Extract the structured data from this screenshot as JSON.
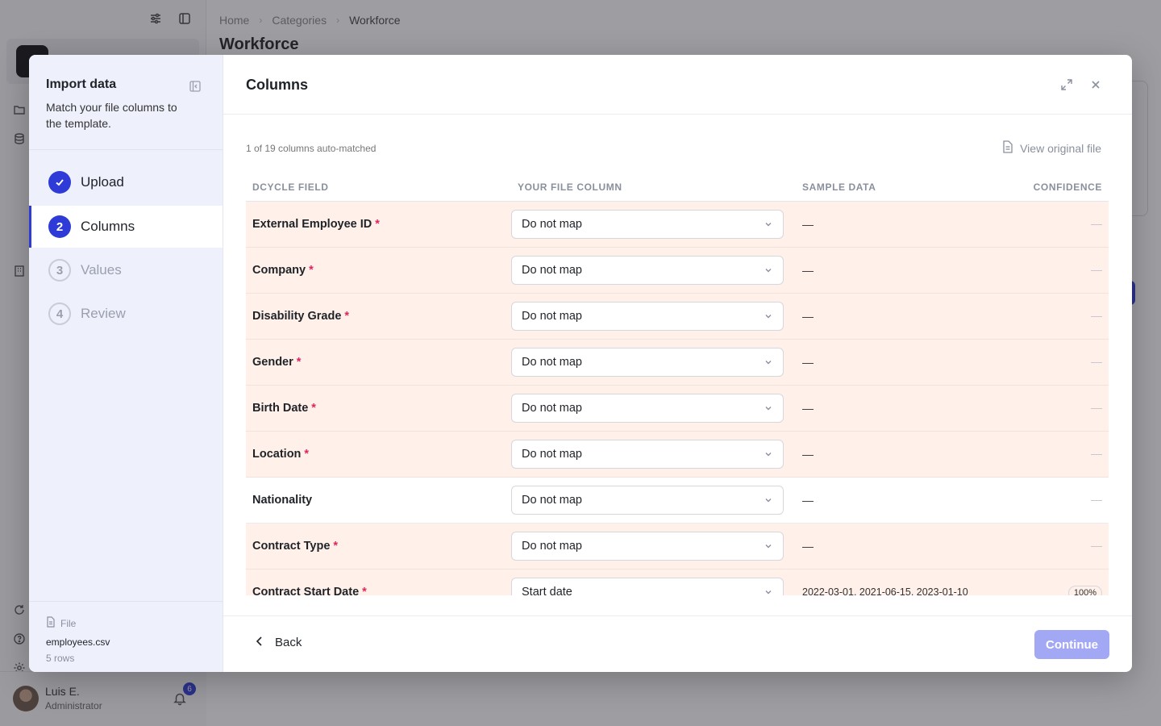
{
  "app": {
    "breadcrumb": [
      "Home",
      "Categories",
      "Workforce"
    ],
    "page_title": "Workforce",
    "user": {
      "name": "Luis E.",
      "role": "Administrator",
      "notifications": "6"
    }
  },
  "modal": {
    "sidebar": {
      "title": "Import data",
      "subtitle": "Match your file columns to the template.",
      "steps": [
        {
          "number": "1",
          "label": "Upload",
          "state": "done"
        },
        {
          "number": "2",
          "label": "Columns",
          "state": "current"
        },
        {
          "number": "3",
          "label": "Values",
          "state": "pending"
        },
        {
          "number": "4",
          "label": "Review",
          "state": "pending"
        }
      ],
      "file": {
        "label": "File",
        "name": "employees.csv",
        "rows": "5 rows"
      }
    },
    "title": "Columns",
    "matched_text": "1 of 19 columns auto-matched",
    "view_original": "View original file",
    "table": {
      "headers": [
        "DCYCLE FIELD",
        "YOUR FILE COLUMN",
        "SAMPLE DATA",
        "CONFIDENCE"
      ],
      "rows": [
        {
          "field": "External Employee ID",
          "required": true,
          "column": "Do not map",
          "sample": "—",
          "confidence": "—"
        },
        {
          "field": "Company",
          "required": true,
          "column": "Do not map",
          "sample": "—",
          "confidence": "—"
        },
        {
          "field": "Disability Grade",
          "required": true,
          "column": "Do not map",
          "sample": "—",
          "confidence": "—"
        },
        {
          "field": "Gender",
          "required": true,
          "column": "Do not map",
          "sample": "—",
          "confidence": "—"
        },
        {
          "field": "Birth Date",
          "required": true,
          "column": "Do not map",
          "sample": "—",
          "confidence": "—"
        },
        {
          "field": "Location",
          "required": true,
          "column": "Do not map",
          "sample": "—",
          "confidence": "—"
        },
        {
          "field": "Nationality",
          "required": false,
          "column": "Do not map",
          "sample": "—",
          "confidence": "—"
        },
        {
          "field": "Contract Type",
          "required": true,
          "column": "Do not map",
          "sample": "—",
          "confidence": "—"
        },
        {
          "field": "Contract Start Date",
          "required": true,
          "column": "Start date",
          "sample": "2022-03-01, 2021-06-15, 2023-01-10",
          "confidence": "100%"
        }
      ]
    },
    "back_label": "Back",
    "continue_label": "Continue",
    "colors": {
      "accent": "#2f3bd6",
      "required_row": "#fff0ea",
      "required_mark": "#e0245e",
      "continue_disabled": "#a3a8f5"
    }
  }
}
